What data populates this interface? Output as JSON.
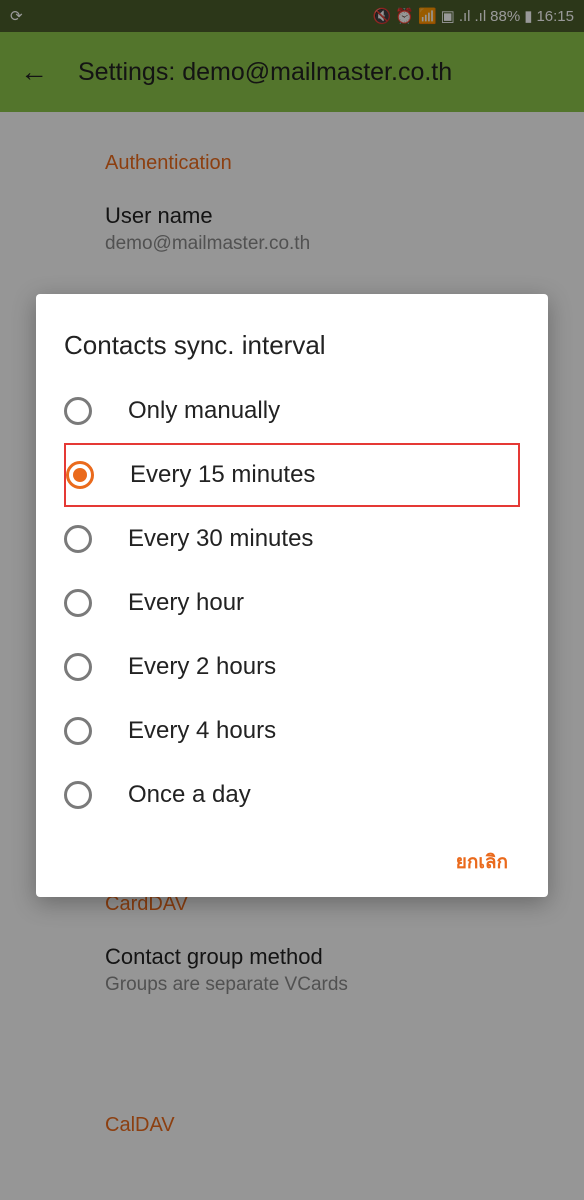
{
  "status_bar": {
    "sync_icon": "⟳",
    "mute_icon": "🔇",
    "alarm_icon": "⏰",
    "wifi_icon": "📶",
    "save_icon": "💾",
    "signal1": "📶",
    "signal2": "📶",
    "battery_pct": "88%",
    "battery_icon": "▮",
    "time": "16:15"
  },
  "header": {
    "title": "Settings: demo@mailmaster.co.th"
  },
  "content": {
    "section1_title": "Authentication",
    "username_label": "User name",
    "username_value": "demo@mailmaster.co.th",
    "section2_title": "CardDAV",
    "contactgroup_label": "Contact group method",
    "contactgroup_value": "Groups are separate VCards",
    "section3_title": "CalDAV"
  },
  "dialog": {
    "title": "Contacts sync. interval",
    "options": [
      {
        "label": "Only manually",
        "selected": false
      },
      {
        "label": "Every 15 minutes",
        "selected": true
      },
      {
        "label": "Every 30 minutes",
        "selected": false
      },
      {
        "label": "Every hour",
        "selected": false
      },
      {
        "label": "Every 2 hours",
        "selected": false
      },
      {
        "label": "Every 4 hours",
        "selected": false
      },
      {
        "label": "Once a day",
        "selected": false
      }
    ],
    "cancel_label": "ยกเลิก"
  }
}
